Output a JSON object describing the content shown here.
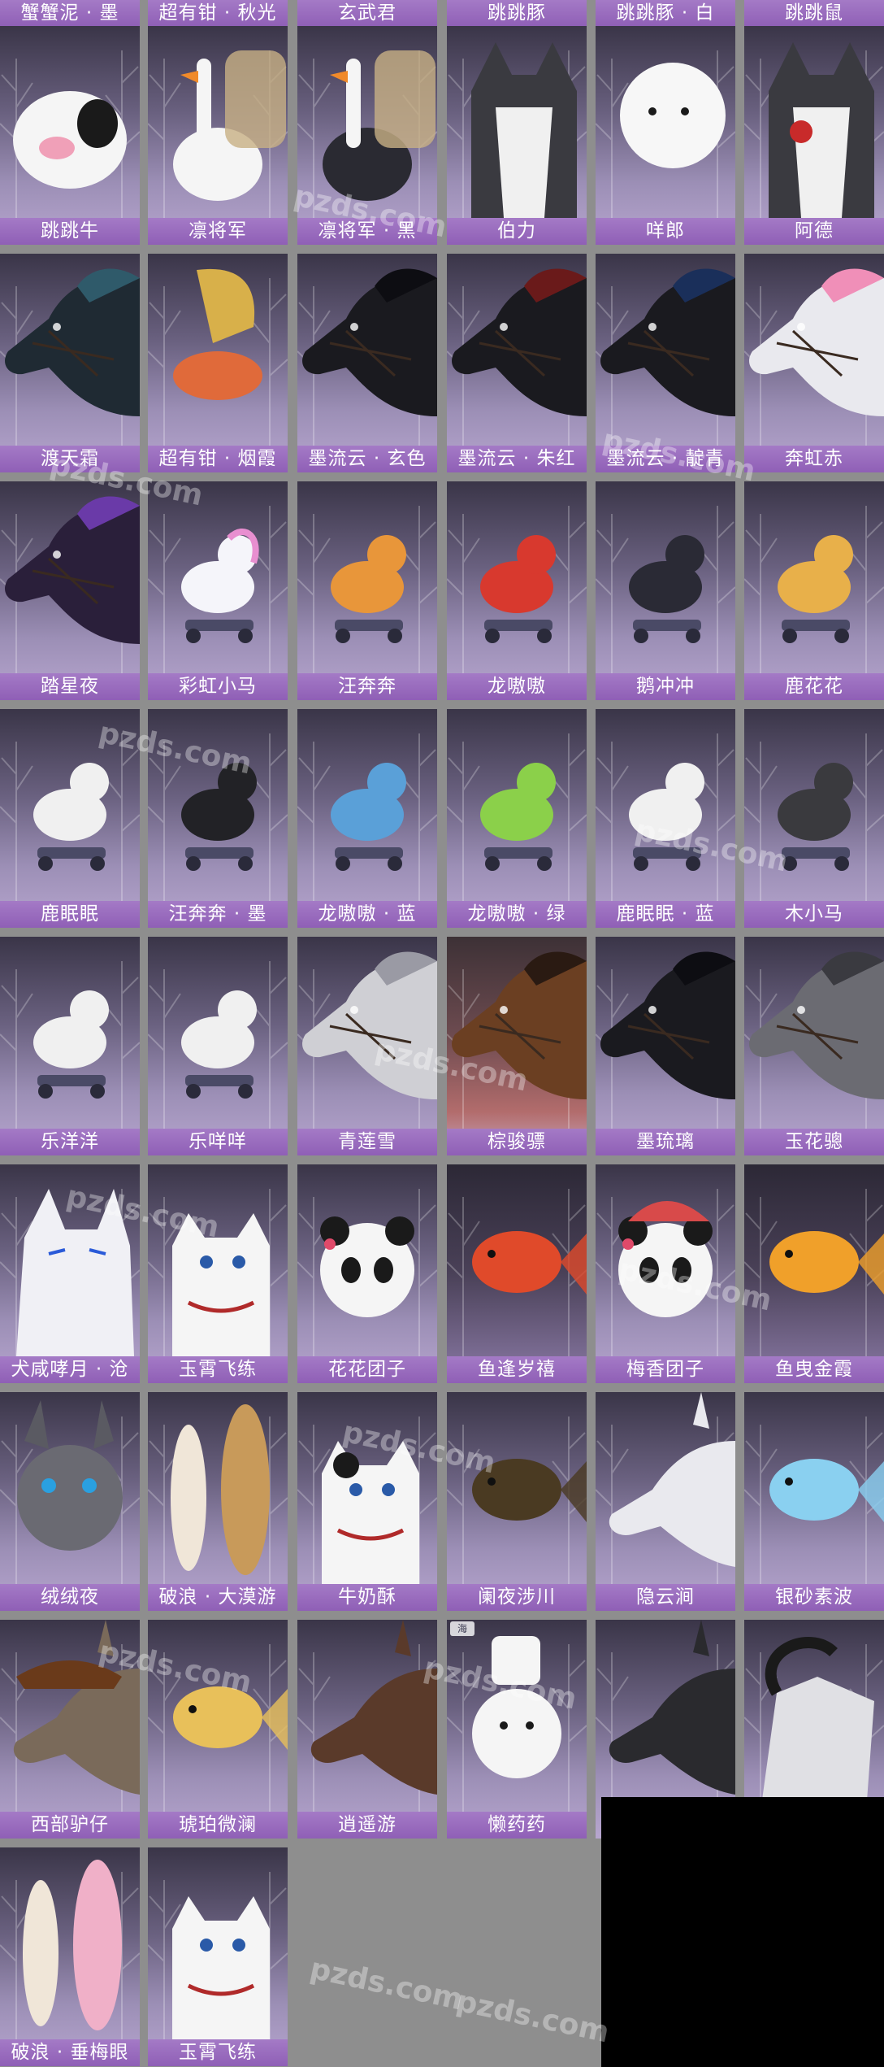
{
  "top_row_partial": [
    "蟹蟹泥 · 墨",
    "超有钳 · 秋光",
    "玄武君",
    "跳跳豚",
    "跳跳豚 · 白",
    "跳跳鼠"
  ],
  "cards": [
    {
      "name": "跳跳牛",
      "badge": "",
      "theme": "cow"
    },
    {
      "name": "凛将军",
      "badge": "",
      "theme": "goose"
    },
    {
      "name": "凛将军 · 黑",
      "badge": "",
      "theme": "goose-dark"
    },
    {
      "name": "伯力",
      "badge": "",
      "theme": "husky"
    },
    {
      "name": "咩郎",
      "badge": "",
      "theme": "white-dog"
    },
    {
      "name": "阿德",
      "badge": "",
      "theme": "husky-rose"
    },
    {
      "name": "渡天霜",
      "badge": "",
      "theme": "horse-teal"
    },
    {
      "name": "超有钳 · 烟霞",
      "badge": "",
      "theme": "crab"
    },
    {
      "name": "墨流云 · 玄色",
      "badge": "",
      "theme": "horse-black"
    },
    {
      "name": "墨流云 · 朱红",
      "badge": "",
      "theme": "horse-black-red"
    },
    {
      "name": "墨流云 · 靛青",
      "badge": "",
      "theme": "horse-black-blue"
    },
    {
      "name": "奔虹赤",
      "badge": "",
      "theme": "horse-white-pink"
    },
    {
      "name": "踏星夜",
      "badge": "",
      "theme": "horse-purple"
    },
    {
      "name": "彩虹小马",
      "badge": "",
      "theme": "toy-pony"
    },
    {
      "name": "汪奔奔",
      "badge": "",
      "theme": "toy-corgi"
    },
    {
      "name": "龙嗷嗷",
      "badge": "",
      "theme": "toy-dino-red"
    },
    {
      "name": "鹅冲冲",
      "badge": "",
      "theme": "toy-penguin"
    },
    {
      "name": "鹿花花",
      "badge": "",
      "theme": "toy-deer"
    },
    {
      "name": "鹿眠眠",
      "badge": "",
      "theme": "toy-deer-white"
    },
    {
      "name": "汪奔奔 · 墨",
      "badge": "",
      "theme": "toy-corgi-black"
    },
    {
      "name": "龙嗷嗷 · 蓝",
      "badge": "",
      "theme": "toy-dino-blue"
    },
    {
      "name": "龙嗷嗷 · 绿",
      "badge": "",
      "theme": "toy-dino-green"
    },
    {
      "name": "鹿眠眠 · 蓝",
      "badge": "",
      "theme": "toy-deer-blue"
    },
    {
      "name": "木小马",
      "badge": "",
      "theme": "toy-wood-horse"
    },
    {
      "name": "乐洋洋",
      "badge": "",
      "theme": "toy-sheep"
    },
    {
      "name": "乐咩咩",
      "badge": "",
      "theme": "toy-sheep"
    },
    {
      "name": "青莲雪",
      "badge": "",
      "theme": "horse-grey"
    },
    {
      "name": "棕骏骠",
      "badge": "",
      "theme": "horse-brown"
    },
    {
      "name": "墨琉璃",
      "badge": "",
      "theme": "horse-black-plain"
    },
    {
      "name": "玉花骢",
      "badge": "",
      "theme": "horse-grey-dark"
    },
    {
      "name": "犬咸哮月 · 沧",
      "badge": "",
      "theme": "wolf"
    },
    {
      "name": "玉霄飞练",
      "badge": "",
      "theme": "cat-white"
    },
    {
      "name": "花花团子",
      "badge": "",
      "theme": "panda"
    },
    {
      "name": "鱼逢岁禧",
      "badge": "",
      "theme": "koi-red"
    },
    {
      "name": "梅香团子",
      "badge": "",
      "theme": "panda-hat"
    },
    {
      "name": "鱼曳金霞",
      "badge": "",
      "theme": "koi-gold"
    },
    {
      "name": "绒绒夜",
      "badge": "",
      "theme": "rabbit-grey"
    },
    {
      "name": "破浪 · 大漠游",
      "badge": "",
      "theme": "surfboard"
    },
    {
      "name": "牛奶酥",
      "badge": "",
      "theme": "cat-cow"
    },
    {
      "name": "阑夜涉川",
      "badge": "",
      "theme": "fish-dark"
    },
    {
      "name": "隐云涧",
      "badge": "",
      "theme": "donkey-white"
    },
    {
      "name": "银砂素波",
      "badge": "",
      "theme": "fish-blue"
    },
    {
      "name": "西部驴仔",
      "badge": "",
      "theme": "donkey-cowboy"
    },
    {
      "name": "琥珀微澜",
      "badge": "",
      "theme": "fish-gold"
    },
    {
      "name": "逍遥游",
      "badge": "",
      "theme": "donkey-brown"
    },
    {
      "name": "懒药药",
      "badge": "海",
      "theme": "bear-white"
    },
    {
      "name": "",
      "badge": "",
      "theme": "donkey-black"
    },
    {
      "name": "",
      "badge": "",
      "theme": "goat"
    },
    {
      "name": "破浪 · 垂梅眼",
      "badge": "",
      "theme": "surfboard-pink"
    },
    {
      "name": "玉霄飞练",
      "badge": "",
      "theme": "cat-white"
    }
  ],
  "watermark_text": "pzds.com",
  "colors": {
    "label_bg": "#9a6cc0",
    "page_bg": "#8e8e8e",
    "label_text": "#ffffff"
  }
}
